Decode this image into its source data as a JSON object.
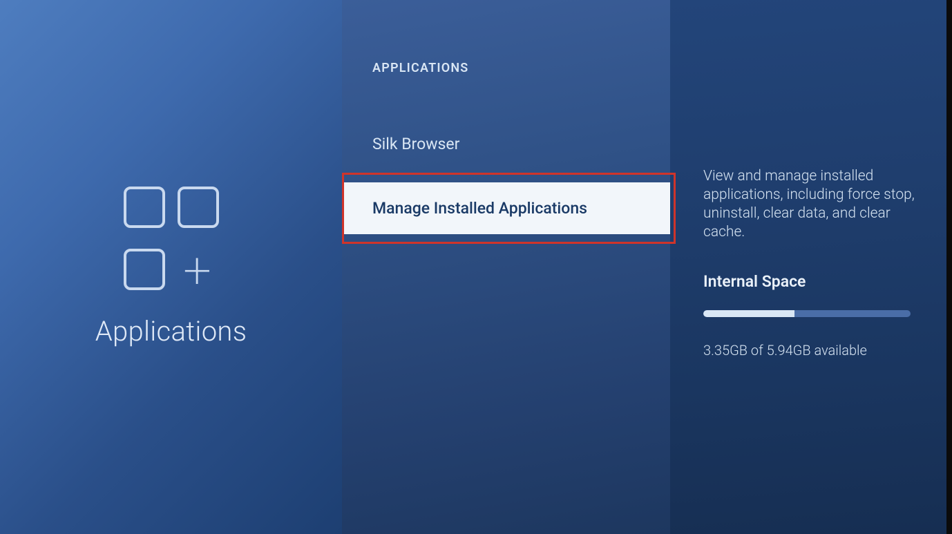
{
  "left": {
    "title": "Applications"
  },
  "middle": {
    "header": "APPLICATIONS",
    "items": [
      {
        "label": "Silk Browser",
        "selected": false
      },
      {
        "label": "Manage Installed Applications",
        "selected": true
      }
    ]
  },
  "right": {
    "description": "View and manage installed applications, including force stop, uninstall, clear data, and clear cache.",
    "storage_heading": "Internal Space",
    "storage_used_gb": 3.35,
    "storage_total_gb": 5.94,
    "storage_text": "3.35GB of 5.94GB available",
    "progress_fill_percent": 44
  }
}
